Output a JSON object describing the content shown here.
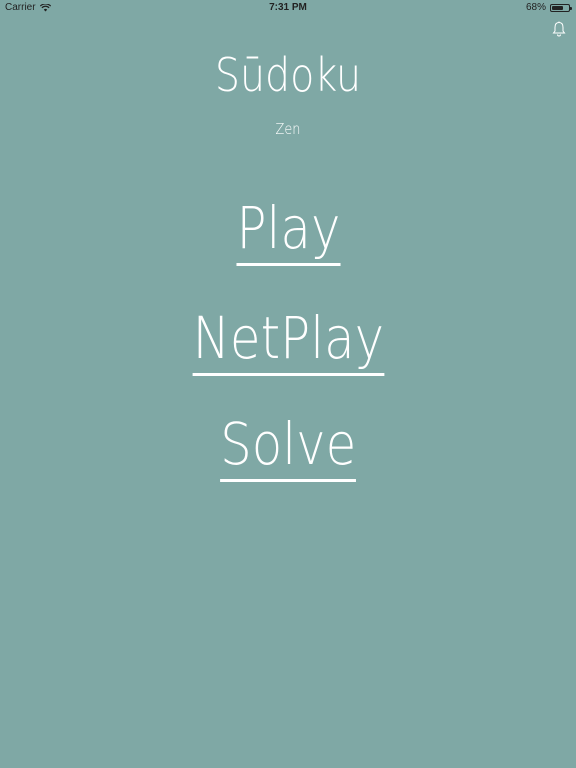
{
  "status_bar": {
    "carrier": "Carrier",
    "time": "7:31 PM",
    "battery_percent": "68%",
    "battery_level": 0.68
  },
  "header": {
    "title": "Sūdoku",
    "subtitle": "Zen"
  },
  "menu": {
    "play": "Play",
    "netplay": "NetPlay",
    "solve": "Solve"
  },
  "colors": {
    "background": "#7fa8a5",
    "text": "#ffffff"
  },
  "icons": {
    "notifications": "bell-icon",
    "wifi": "wifi-icon",
    "battery": "battery-icon"
  }
}
